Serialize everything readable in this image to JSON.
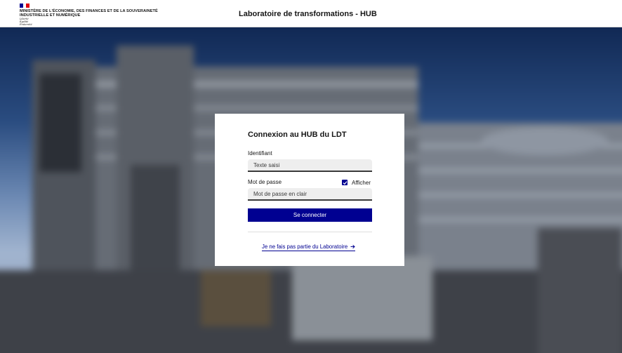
{
  "colors": {
    "accent": "#000091",
    "flag_blue": "#000091",
    "flag_white": "#ffffff",
    "flag_red": "#e1000f",
    "text": "#161616",
    "input_background": "#eeeeee"
  },
  "header": {
    "logo": {
      "ministry_name": "MINISTÈRE DE L'ÉCONOMIE, DES FINANCES ET DE LA SOUVERAINETÉ INDUSTRIELLE ET NUMÉRIQUE",
      "motto": [
        "Liberté",
        "Égalité",
        "Fraternité"
      ]
    },
    "title": "Laboratoire de transformations - HUB"
  },
  "background": {
    "icon": "ministry-building-photo"
  },
  "login": {
    "title": "Connexion au HUB du LDT",
    "username": {
      "label": "Identifiant",
      "placeholder": "Texte saisi"
    },
    "password": {
      "label": "Mot de passe",
      "placeholder": "Mot de passe en clair",
      "show_label": "Afficher",
      "show_checked": true
    },
    "submit_label": "Se connecter",
    "not_member_link": "Je ne fais pas partie du Laboratoire",
    "link_icon": "arrow-right-icon"
  }
}
